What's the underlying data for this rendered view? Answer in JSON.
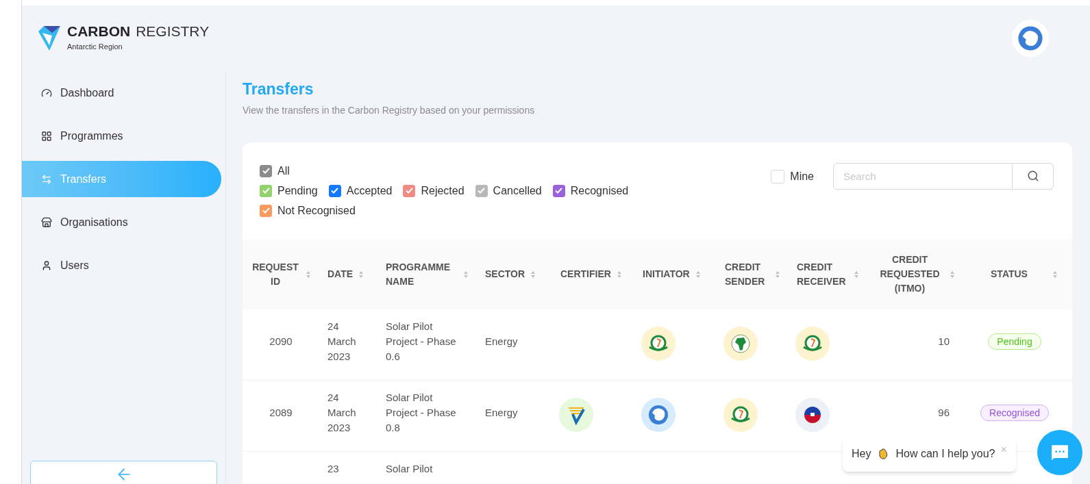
{
  "brand": {
    "name": "CARBON",
    "name_suffix": "REGISTRY",
    "region": "Antarctic Region"
  },
  "sidebar": {
    "items": [
      {
        "label": "Dashboard",
        "selected": false
      },
      {
        "label": "Programmes",
        "selected": false
      },
      {
        "label": "Transfers",
        "selected": true
      },
      {
        "label": "Organisations",
        "selected": false
      },
      {
        "label": "Users",
        "selected": false
      }
    ]
  },
  "page": {
    "title": "Transfers",
    "subtitle": "View the transfers in the Carbon Registry based on your permissions"
  },
  "filters": [
    {
      "label": "All",
      "checked": true,
      "color": "#8c8c8c"
    },
    {
      "label": "Pending",
      "checked": true,
      "color": "#94d26e"
    },
    {
      "label": "Accepted",
      "checked": true,
      "color": "#1677ff"
    },
    {
      "label": "Rejected",
      "checked": true,
      "color": "#f08a85"
    },
    {
      "label": "Cancelled",
      "checked": true,
      "color": "#b8b8b8"
    },
    {
      "label": "Recognised",
      "checked": true,
      "color": "#9b63db"
    },
    {
      "label": "Not Recognised",
      "checked": true,
      "color": "#fb9a5e"
    }
  ],
  "mine": {
    "label": "Mine",
    "checked": false
  },
  "search": {
    "placeholder": "Search"
  },
  "table": {
    "columns": [
      "REQUEST ID",
      "DATE",
      "PROGRAMME NAME",
      "SECTOR",
      "CERTIFIER",
      "INITIATOR",
      "CREDIT SENDER",
      "CREDIT RECEIVER",
      "CREDIT REQUESTED (ITMO)",
      "STATUS"
    ],
    "rows": [
      {
        "request_id": "2090",
        "date": "24 March 2023",
        "programme": "Solar Pilot Project - Phase 0.6",
        "sector": "Energy",
        "initiator": {
          "kind": "seal"
        },
        "sender": {
          "kind": "africa"
        },
        "receiver": {
          "kind": "seal"
        },
        "credit": "10",
        "status": {
          "label": "Pending",
          "kind": "pending"
        }
      },
      {
        "request_id": "2089",
        "date": "24 March 2023",
        "programme": "Solar Pilot Project - Phase 0.8",
        "sector": "Energy",
        "certifier": {
          "kind": "check"
        },
        "initiator": {
          "kind": "antarctica"
        },
        "sender": {
          "kind": "seal"
        },
        "receiver": {
          "kind": "flag"
        },
        "credit": "96",
        "status": {
          "label": "Recognised",
          "kind": "recognised"
        }
      },
      {
        "date": "23",
        "programme": "Solar Pilot"
      }
    ]
  },
  "chat": {
    "greeting": "Hey",
    "message": "How can I help you?",
    "close": "×"
  }
}
